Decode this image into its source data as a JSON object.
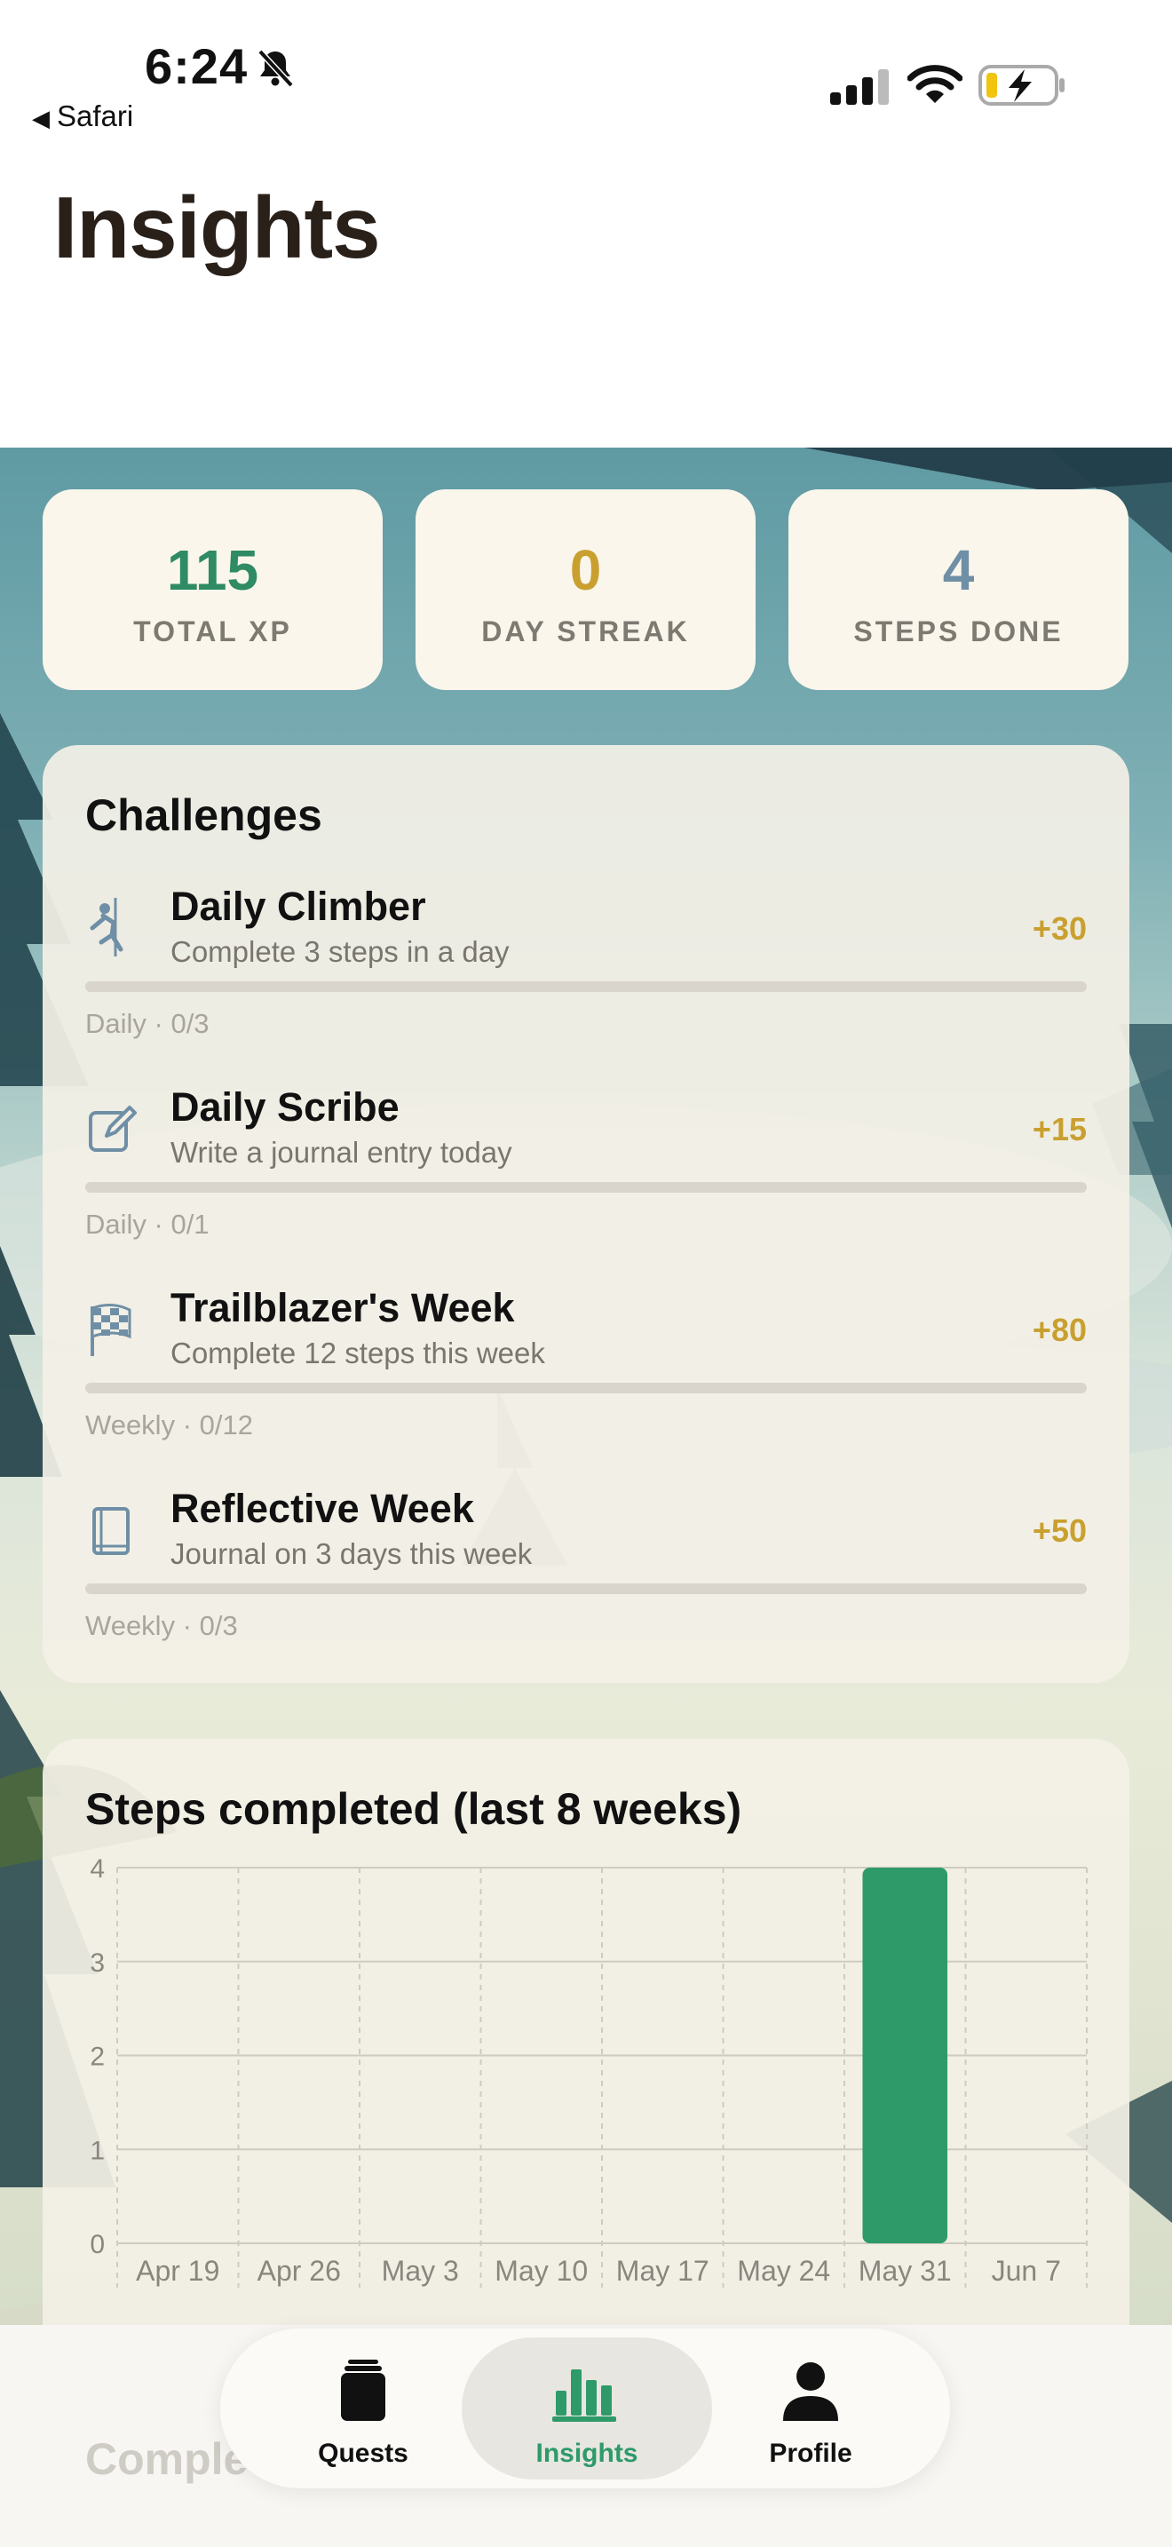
{
  "status": {
    "time": "6:24",
    "back_label": "Safari"
  },
  "page": {
    "title": "Insights"
  },
  "stats": [
    {
      "value": "115",
      "label": "TOTAL XP",
      "color": "#2e8b63"
    },
    {
      "value": "0",
      "label": "DAY STREAK",
      "color": "#c9a030"
    },
    {
      "value": "4",
      "label": "STEPS DONE",
      "color": "#6f8fa6"
    }
  ],
  "challenges": {
    "title": "Challenges",
    "items": [
      {
        "icon": "climber-icon",
        "name": "Daily Climber",
        "desc": "Complete 3 steps in a day",
        "xp": "+30",
        "meta": "Daily · 0/3",
        "progress": 0
      },
      {
        "icon": "edit-icon",
        "name": "Daily Scribe",
        "desc": "Write a journal entry today",
        "xp": "+15",
        "meta": "Daily · 0/1",
        "progress": 0
      },
      {
        "icon": "checkered-flag-icon",
        "name": "Trailblazer's Week",
        "desc": "Complete 12 steps this week",
        "xp": "+80",
        "meta": "Weekly · 0/12",
        "progress": 0
      },
      {
        "icon": "book-icon",
        "name": "Reflective Week",
        "desc": "Journal on 3 days this week",
        "xp": "+50",
        "meta": "Weekly · 0/3",
        "progress": 0
      }
    ]
  },
  "chart_data": {
    "type": "bar",
    "title": "Steps completed (last 8 weeks)",
    "categories": [
      "Apr 19",
      "Apr 26",
      "May 3",
      "May 10",
      "May 17",
      "May 24",
      "May 31",
      "Jun 7"
    ],
    "values": [
      0,
      0,
      0,
      0,
      0,
      0,
      4,
      0
    ],
    "yticks": [
      0,
      1,
      2,
      3,
      4
    ],
    "ylim": [
      0,
      4
    ],
    "xlabel": "",
    "ylabel": "",
    "bar_color": "#2e9a6a",
    "grid": true
  },
  "bottom": {
    "partial_title": "Comple"
  },
  "tabs": [
    {
      "label": "Quests",
      "icon": "quests-icon",
      "active": false
    },
    {
      "label": "Insights",
      "icon": "bar-chart-icon",
      "active": true
    },
    {
      "label": "Profile",
      "icon": "person-icon",
      "active": false
    }
  ]
}
